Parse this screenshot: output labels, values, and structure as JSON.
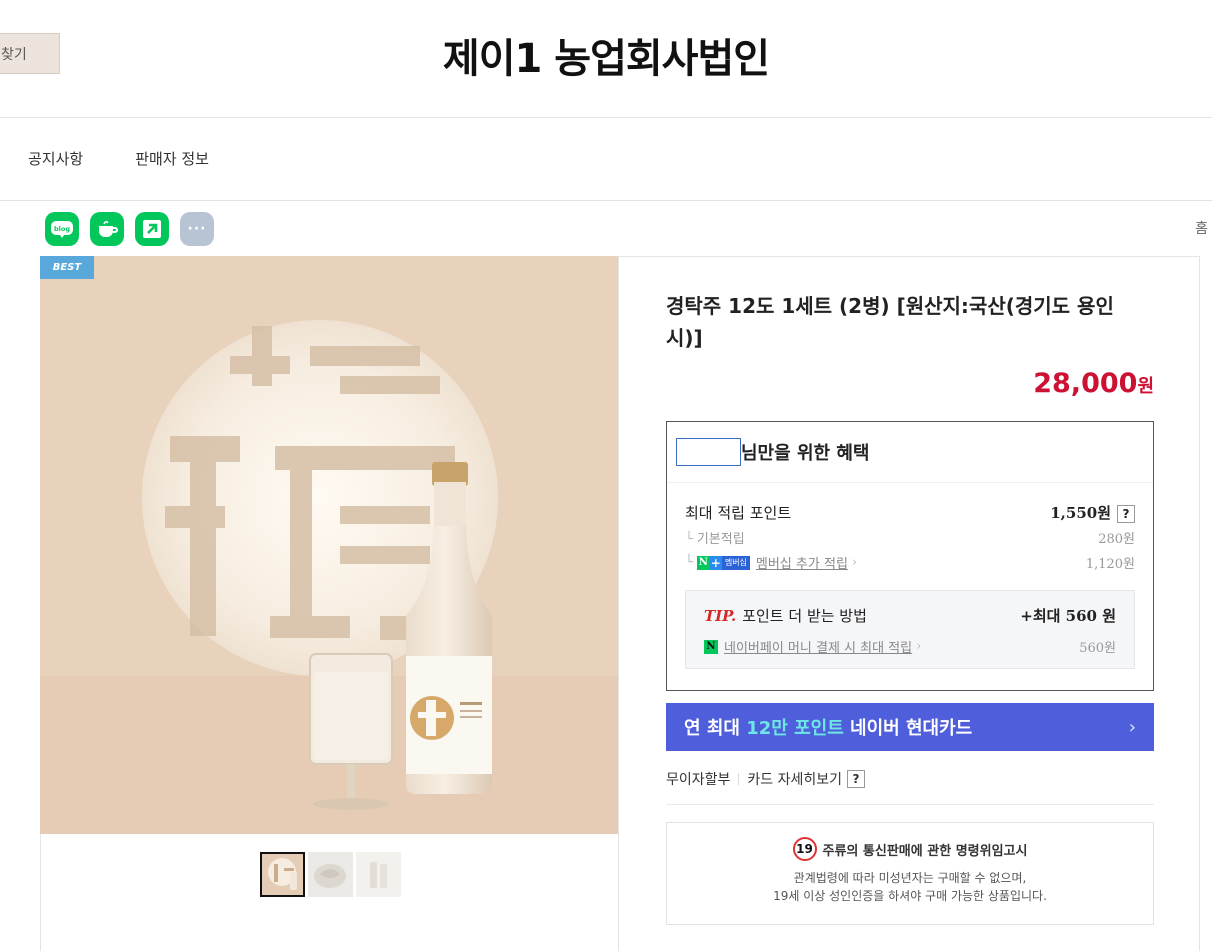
{
  "header": {
    "left_button": "찾기",
    "store_name": "제이1 농업회사법인"
  },
  "nav": {
    "items": [
      "공지사항",
      "판매자 정보"
    ]
  },
  "share": {
    "icons": [
      "blog-icon",
      "cafe-icon",
      "band-icon",
      "more-icon"
    ],
    "home_label": "홈"
  },
  "gallery": {
    "badge": "BEST",
    "thumbnail_count": 3,
    "selected_thumbnail": 0
  },
  "product": {
    "title": "경탁주 12도 1세트 (2병) [원산지:국산(경기도 용인시)]",
    "price": "28,000",
    "price_unit": "원",
    "accent_color": "#cc1133"
  },
  "benefit": {
    "heading": "님만을 위한 혜택",
    "max_points_label": "최대 적립 포인트",
    "max_points_value": "1,550원",
    "help": "?",
    "basic_label": "기본적립",
    "basic_value": "280원",
    "membership_label": "멤버십 추가 적립",
    "membership_value": "1,120원",
    "badge_n": "N",
    "badge_plus": "+",
    "badge_mem": "멤버십",
    "tip_prefix": "TIP.",
    "tip_label": "포인트 더 받는 방법",
    "tip_value": "+최대 560 원",
    "npay_label": "네이버페이 머니 결제 시 최대 적립",
    "npay_value": "560원"
  },
  "card_banner": {
    "prefix": "연 최대 ",
    "highlight": "12만 포인트",
    "suffix": " 네이버 현대카드",
    "arrow": "›",
    "color": "#4f5fdb"
  },
  "installment": {
    "label": "무이자할부",
    "card_detail": "카드 자세히보기",
    "help": "?"
  },
  "notice": {
    "age": "19",
    "title": "주류의 통신판매에 관한 명령위임고시",
    "line1": "관계법령에 따라 미성년자는 구매할 수 없으며,",
    "line2": "19세 이상 성인인증을 하셔야 구매 가능한 상품입니다."
  }
}
